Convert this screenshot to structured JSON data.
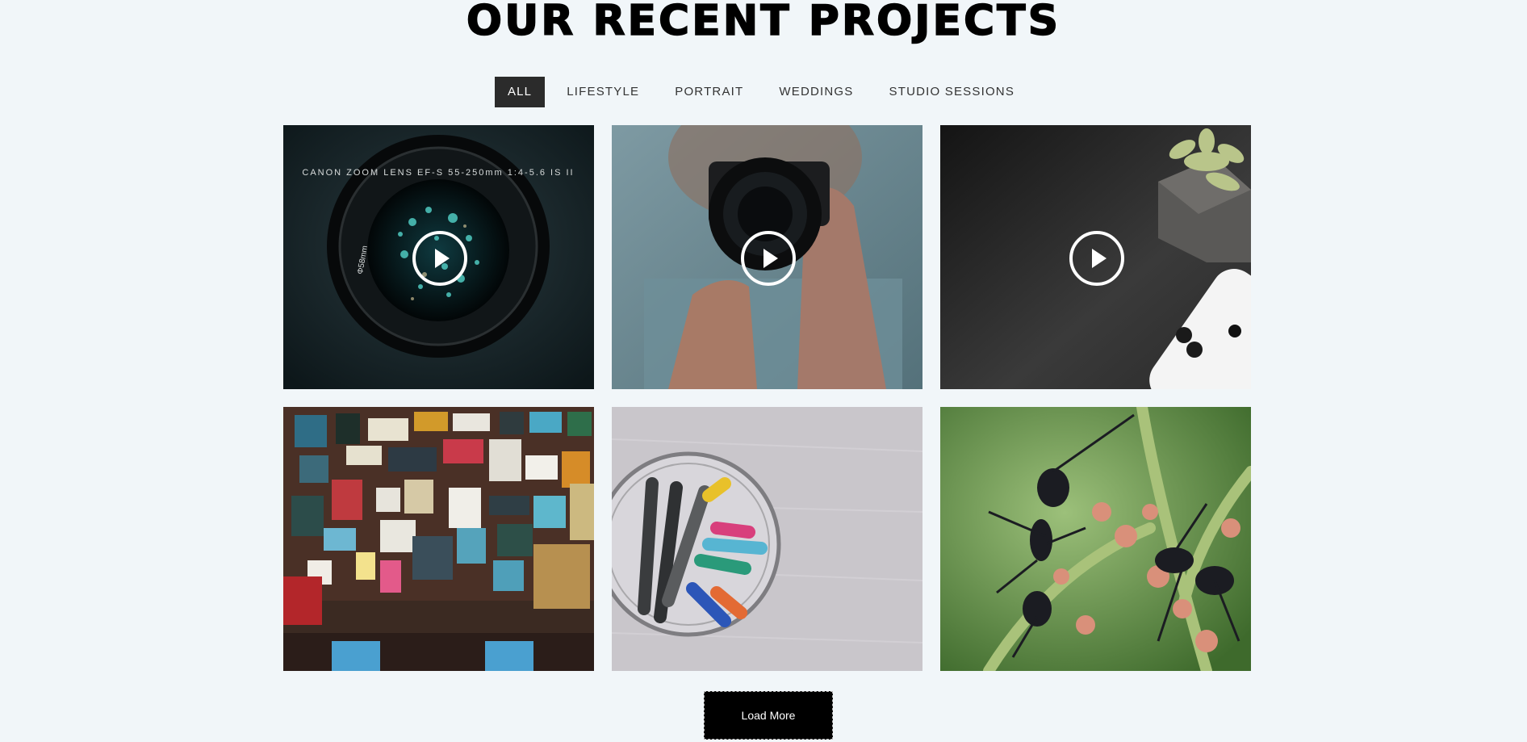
{
  "section": {
    "title": "OUR RECENT PROJECTS"
  },
  "filters": [
    {
      "label": "ALL",
      "active": true
    },
    {
      "label": "LIFESTYLE",
      "active": false
    },
    {
      "label": "PORTRAIT",
      "active": false
    },
    {
      "label": "WEDDINGS",
      "active": false
    },
    {
      "label": "STUDIO SESSIONS",
      "active": false
    }
  ],
  "gallery": {
    "items": [
      {
        "subject": "camera lens closeup",
        "has_play": true,
        "lens_text": "CANON ZOOM LENS EF-S 55-250mm 1:4-5.6 IS II",
        "lens_size": "Φ58mm"
      },
      {
        "subject": "photographer holding camera",
        "has_play": true
      },
      {
        "subject": "smartphone and succulent on dark surface",
        "has_play": true
      },
      {
        "subject": "wall of framed signs",
        "has_play": false
      },
      {
        "subject": "markers in glass jar",
        "has_play": false
      },
      {
        "subject": "ants on plant",
        "has_play": false
      }
    ]
  },
  "actions": {
    "load_more_label": "Load More"
  },
  "colors": {
    "background": "#f1f6f9",
    "active_filter_bg": "#2b2b2b",
    "button_bg": "#000000"
  }
}
